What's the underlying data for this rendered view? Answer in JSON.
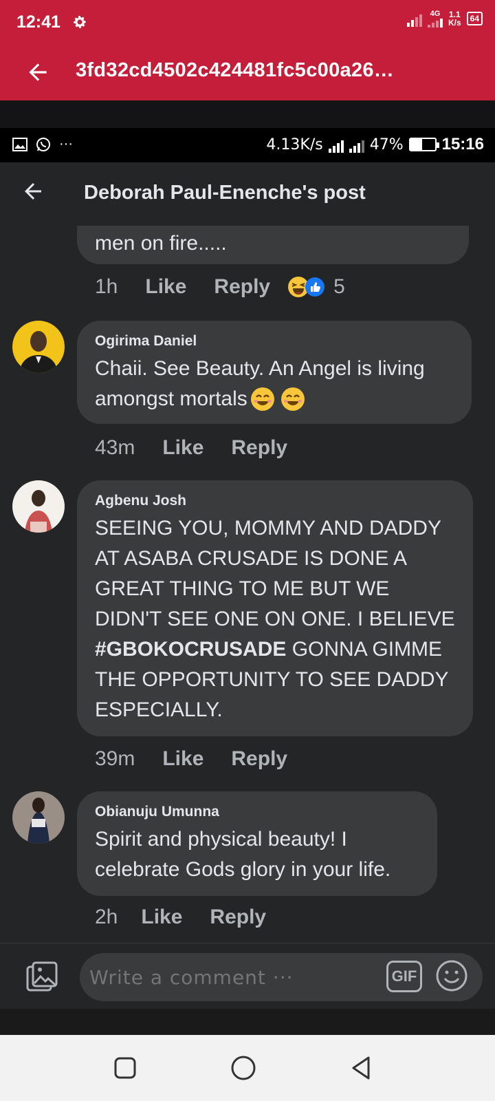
{
  "outer_status": {
    "time": "12:41",
    "network": "4G",
    "speed_top": "1.1",
    "speed_bottom": "K/s",
    "battery": "64"
  },
  "outer_toolbar": {
    "title": "3fd32cd4502c424481fc5c00a26…"
  },
  "inner_status": {
    "more": "···",
    "speed": "4.13K/s",
    "battery_percent": "47%",
    "battery_level": 0.47,
    "time": "15:16"
  },
  "header": {
    "title": "Deborah Paul-Enenche's post"
  },
  "comments": [
    {
      "text": "men on fire.....",
      "time": "1h",
      "like": "Like",
      "reply": "Reply",
      "reaction_count": "5"
    },
    {
      "author": "Ogirima Daniel",
      "text_line1": "Chaii. See Beauty. An Angel is living",
      "text_line2": "amongst mortals",
      "time": "43m",
      "like": "Like",
      "reply": "Reply"
    },
    {
      "author": "Agbenu Josh",
      "text_before": "SEEING YOU, MOMMY AND DADDY AT ASABA CRUSADE IS DONE A GREAT THING TO ME BUT WE DIDN'T SEE ONE ON ONE. I BELIEVE ",
      "hashtag": "#GBOKOCRUSADE",
      "text_after": " GONNA GIMME THE OPPORTUNITY TO SEE DADDY ESPECIALLY.",
      "time": "39m",
      "like": "Like",
      "reply": "Reply"
    },
    {
      "author": "Obianuju Umunna",
      "text": "Spirit and physical beauty! I celebrate Gods glory in your life.",
      "time": "2h",
      "like": "Like",
      "reply": "Reply"
    }
  ],
  "composer": {
    "placeholder": "Write a comment ···",
    "gif_label": "GIF"
  },
  "colors": {
    "brand": "#c41e3a",
    "surface": "#242526",
    "bubble": "#3a3b3c",
    "text": "#e4e6eb",
    "muted": "#b0b3b8"
  }
}
